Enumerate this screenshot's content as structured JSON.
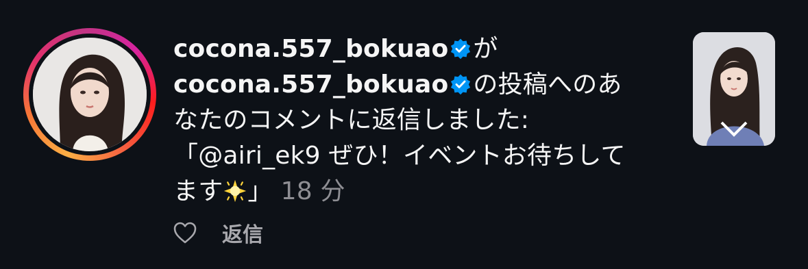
{
  "notification": {
    "actor_username": "cocona.557_bokuao",
    "particle_ga": "が",
    "post_owner_username": "cocona.557_bokuao",
    "text_part1": "の投稿へのあ",
    "text_part2": "なたのコメントに返信しました:",
    "quote_line1": "「@airi_ek9 ぜひ！イベントお待ちして",
    "quote_line2_start": "ます",
    "quote_close": "」",
    "emoji": "sparkle-star-emoji",
    "time": "18 分",
    "reply_label": "返信"
  },
  "colors": {
    "background": "#0d1117",
    "verified_badge": "#0095f6",
    "muted_text": "#8e8e93",
    "story_ring": [
      "#fcaf45",
      "#e1306c",
      "#c13584"
    ]
  }
}
